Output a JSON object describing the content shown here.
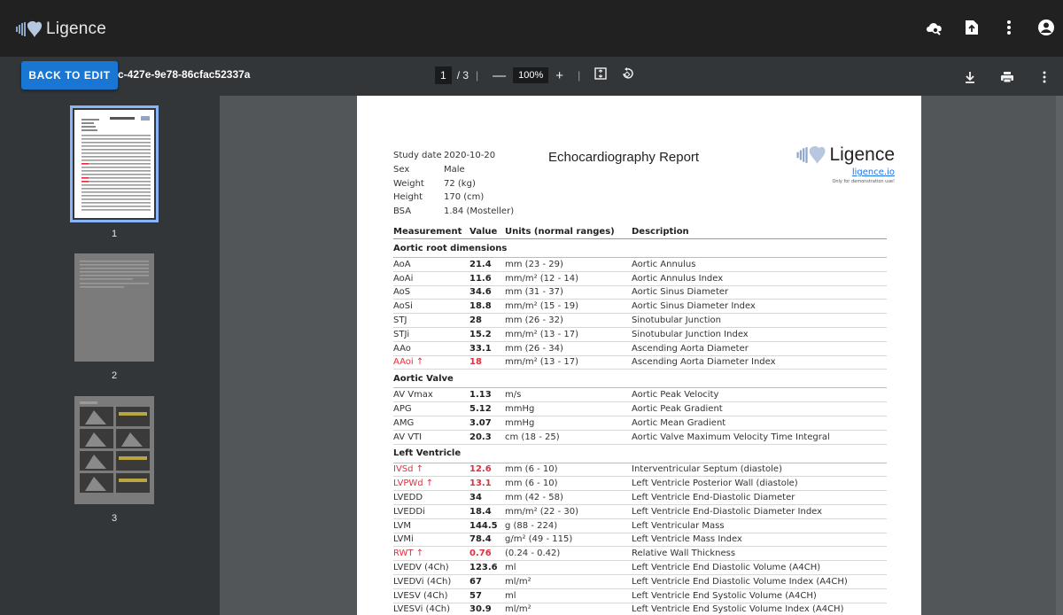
{
  "header": {
    "app_name": "Ligence"
  },
  "toolbar": {
    "back_label": "BACK TO EDIT",
    "doc_name": "c-427e-9e78-86cfac52337a",
    "page_current": "1",
    "page_total": "/ 3",
    "zoom": "100%"
  },
  "thumbnails": [
    {
      "label": "1"
    },
    {
      "label": "2"
    },
    {
      "label": "3"
    }
  ],
  "report": {
    "title": "Echocardiography Report",
    "logo_text": "Ligence",
    "link": "ligence.io",
    "note": "Only for demonstration use!",
    "patient": [
      {
        "key": "Study date",
        "value": "2020-10-20"
      },
      {
        "key": "Sex",
        "value": "Male"
      },
      {
        "key": "Weight",
        "value": "72 (kg)"
      },
      {
        "key": "Height",
        "value": "170 (cm)"
      },
      {
        "key": "BSA",
        "value": "1.84 (Mosteller)"
      }
    ],
    "columns": [
      "Measurement",
      "Value",
      "Units (normal ranges)",
      "Description"
    ],
    "rows": [
      {
        "kind": "section",
        "label": "Aortic root dimensions"
      },
      {
        "kind": "row",
        "m": "AoA",
        "v": "21.4",
        "u": "mm (23 - 29)",
        "d": "Aortic Annulus"
      },
      {
        "kind": "row",
        "m": "AoAi",
        "v": "11.6",
        "u": "mm/m² (12 - 14)",
        "d": "Aortic Annulus Index"
      },
      {
        "kind": "row",
        "m": "AoS",
        "v": "34.6",
        "u": "mm (31 - 37)",
        "d": "Aortic Sinus Diameter"
      },
      {
        "kind": "row",
        "m": "AoSi",
        "v": "18.8",
        "u": "mm/m² (15 - 19)",
        "d": "Aortic Sinus Diameter Index"
      },
      {
        "kind": "row",
        "m": "STJ",
        "v": "28",
        "u": "mm (26 - 32)",
        "d": "Sinotubular Junction"
      },
      {
        "kind": "row",
        "m": "STJi",
        "v": "15.2",
        "u": "mm/m² (13 - 17)",
        "d": "Sinotubular Junction Index"
      },
      {
        "kind": "row",
        "m": "AAo",
        "v": "33.1",
        "u": "mm (26 - 34)",
        "d": "Ascending Aorta Diameter"
      },
      {
        "kind": "row",
        "flag": true,
        "m": "AAoi ↑",
        "v": "18",
        "u": "mm/m² (13 - 17)",
        "d": "Ascending Aorta Diameter Index"
      },
      {
        "kind": "section",
        "label": "Aortic Valve"
      },
      {
        "kind": "row",
        "m": "AV Vmax",
        "v": "1.13",
        "u": "m/s",
        "d": "Aortic Peak Velocity"
      },
      {
        "kind": "row",
        "m": "APG",
        "v": "5.12",
        "u": "mmHg",
        "d": "Aortic Peak Gradient"
      },
      {
        "kind": "row",
        "m": "AMG",
        "v": "3.07",
        "u": "mmHg",
        "d": "Aortic Mean Gradient"
      },
      {
        "kind": "row",
        "m": "AV VTI",
        "v": "20.3",
        "u": "cm (18 - 25)",
        "d": "Aortic Valve Maximum Velocity Time Integral"
      },
      {
        "kind": "section",
        "label": "Left Ventricle"
      },
      {
        "kind": "row",
        "flag": true,
        "m": "IVSd ↑",
        "v": "12.6",
        "u": "mm (6 - 10)",
        "d": "Interventricular Septum (diastole)"
      },
      {
        "kind": "row",
        "flag": true,
        "m": "LVPWd ↑",
        "v": "13.1",
        "u": "mm (6 - 10)",
        "d": "Left Ventricle Posterior Wall (diastole)"
      },
      {
        "kind": "row",
        "m": "LVEDD",
        "v": "34",
        "u": "mm (42 - 58)",
        "d": "Left Ventricle End-Diastolic Diameter"
      },
      {
        "kind": "row",
        "m": "LVEDDi",
        "v": "18.4",
        "u": "mm/m² (22 - 30)",
        "d": "Left Ventricle End-Diastolic Diameter Index"
      },
      {
        "kind": "row",
        "m": "LVM",
        "v": "144.5",
        "u": "g (88 - 224)",
        "d": "Left Ventricular Mass"
      },
      {
        "kind": "row",
        "m": "LVMi",
        "v": "78.4",
        "u": "g/m² (49 - 115)",
        "d": "Left Ventricle Mass Index"
      },
      {
        "kind": "row",
        "flag": true,
        "m": "RWT ↑",
        "v": "0.76",
        "u": "(0.24 - 0.42)",
        "d": "Relative Wall Thickness"
      },
      {
        "kind": "row",
        "m": "LVEDV (4Ch)",
        "v": "123.6",
        "u": "ml",
        "d": "Left Ventricle End Diastolic Volume (A4CH)"
      },
      {
        "kind": "row",
        "m": "LVEDVi (4Ch)",
        "v": "67",
        "u": "ml/m²",
        "d": "Left Ventricle End Diastolic Volume Index (A4CH)"
      },
      {
        "kind": "row",
        "m": "LVESV (4Ch)",
        "v": "57",
        "u": "ml",
        "d": "Left Ventricle End Systolic Volume (A4CH)"
      },
      {
        "kind": "row",
        "m": "LVESVi (4Ch)",
        "v": "30.9",
        "u": "ml/m²",
        "d": "Left Ventricle End Systolic Volume Index (A4CH)"
      }
    ]
  }
}
